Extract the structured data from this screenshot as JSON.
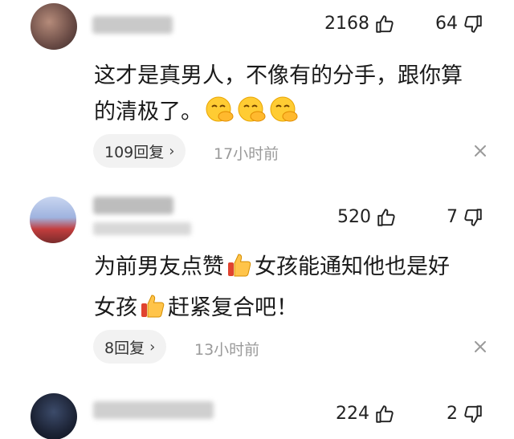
{
  "comments": [
    {
      "likes": "2168",
      "dislikes": "64",
      "text_line1": "这才是真男人，不像有的分手，跟你算",
      "text_line2": "的清极了。",
      "emojis": [
        "face-with-hand-over-mouth",
        "face-with-hand-over-mouth",
        "face-with-hand-over-mouth"
      ],
      "reply_label": "109回复",
      "time": "17小时前"
    },
    {
      "likes": "520",
      "dislikes": "7",
      "text_line1_a": "为前男友点赞",
      "text_line1_b": "女孩能通知他也是好",
      "text_line2_a": "女孩",
      "text_line2_b": "赶紧复合吧！",
      "emojis": [
        "thumbs-up",
        "thumbs-up"
      ],
      "reply_label": "8回复",
      "time": "13小时前"
    },
    {
      "likes": "224",
      "dislikes": "2"
    }
  ],
  "icons": {
    "like": "thumbs-up-outline-icon",
    "dislike": "thumbs-down-outline-icon",
    "close": "close-icon",
    "chevron": "chevron-right"
  },
  "colors": {
    "text": "#1a1a1a",
    "muted": "#9a9a9a",
    "pill_bg": "#f2f2f2"
  }
}
